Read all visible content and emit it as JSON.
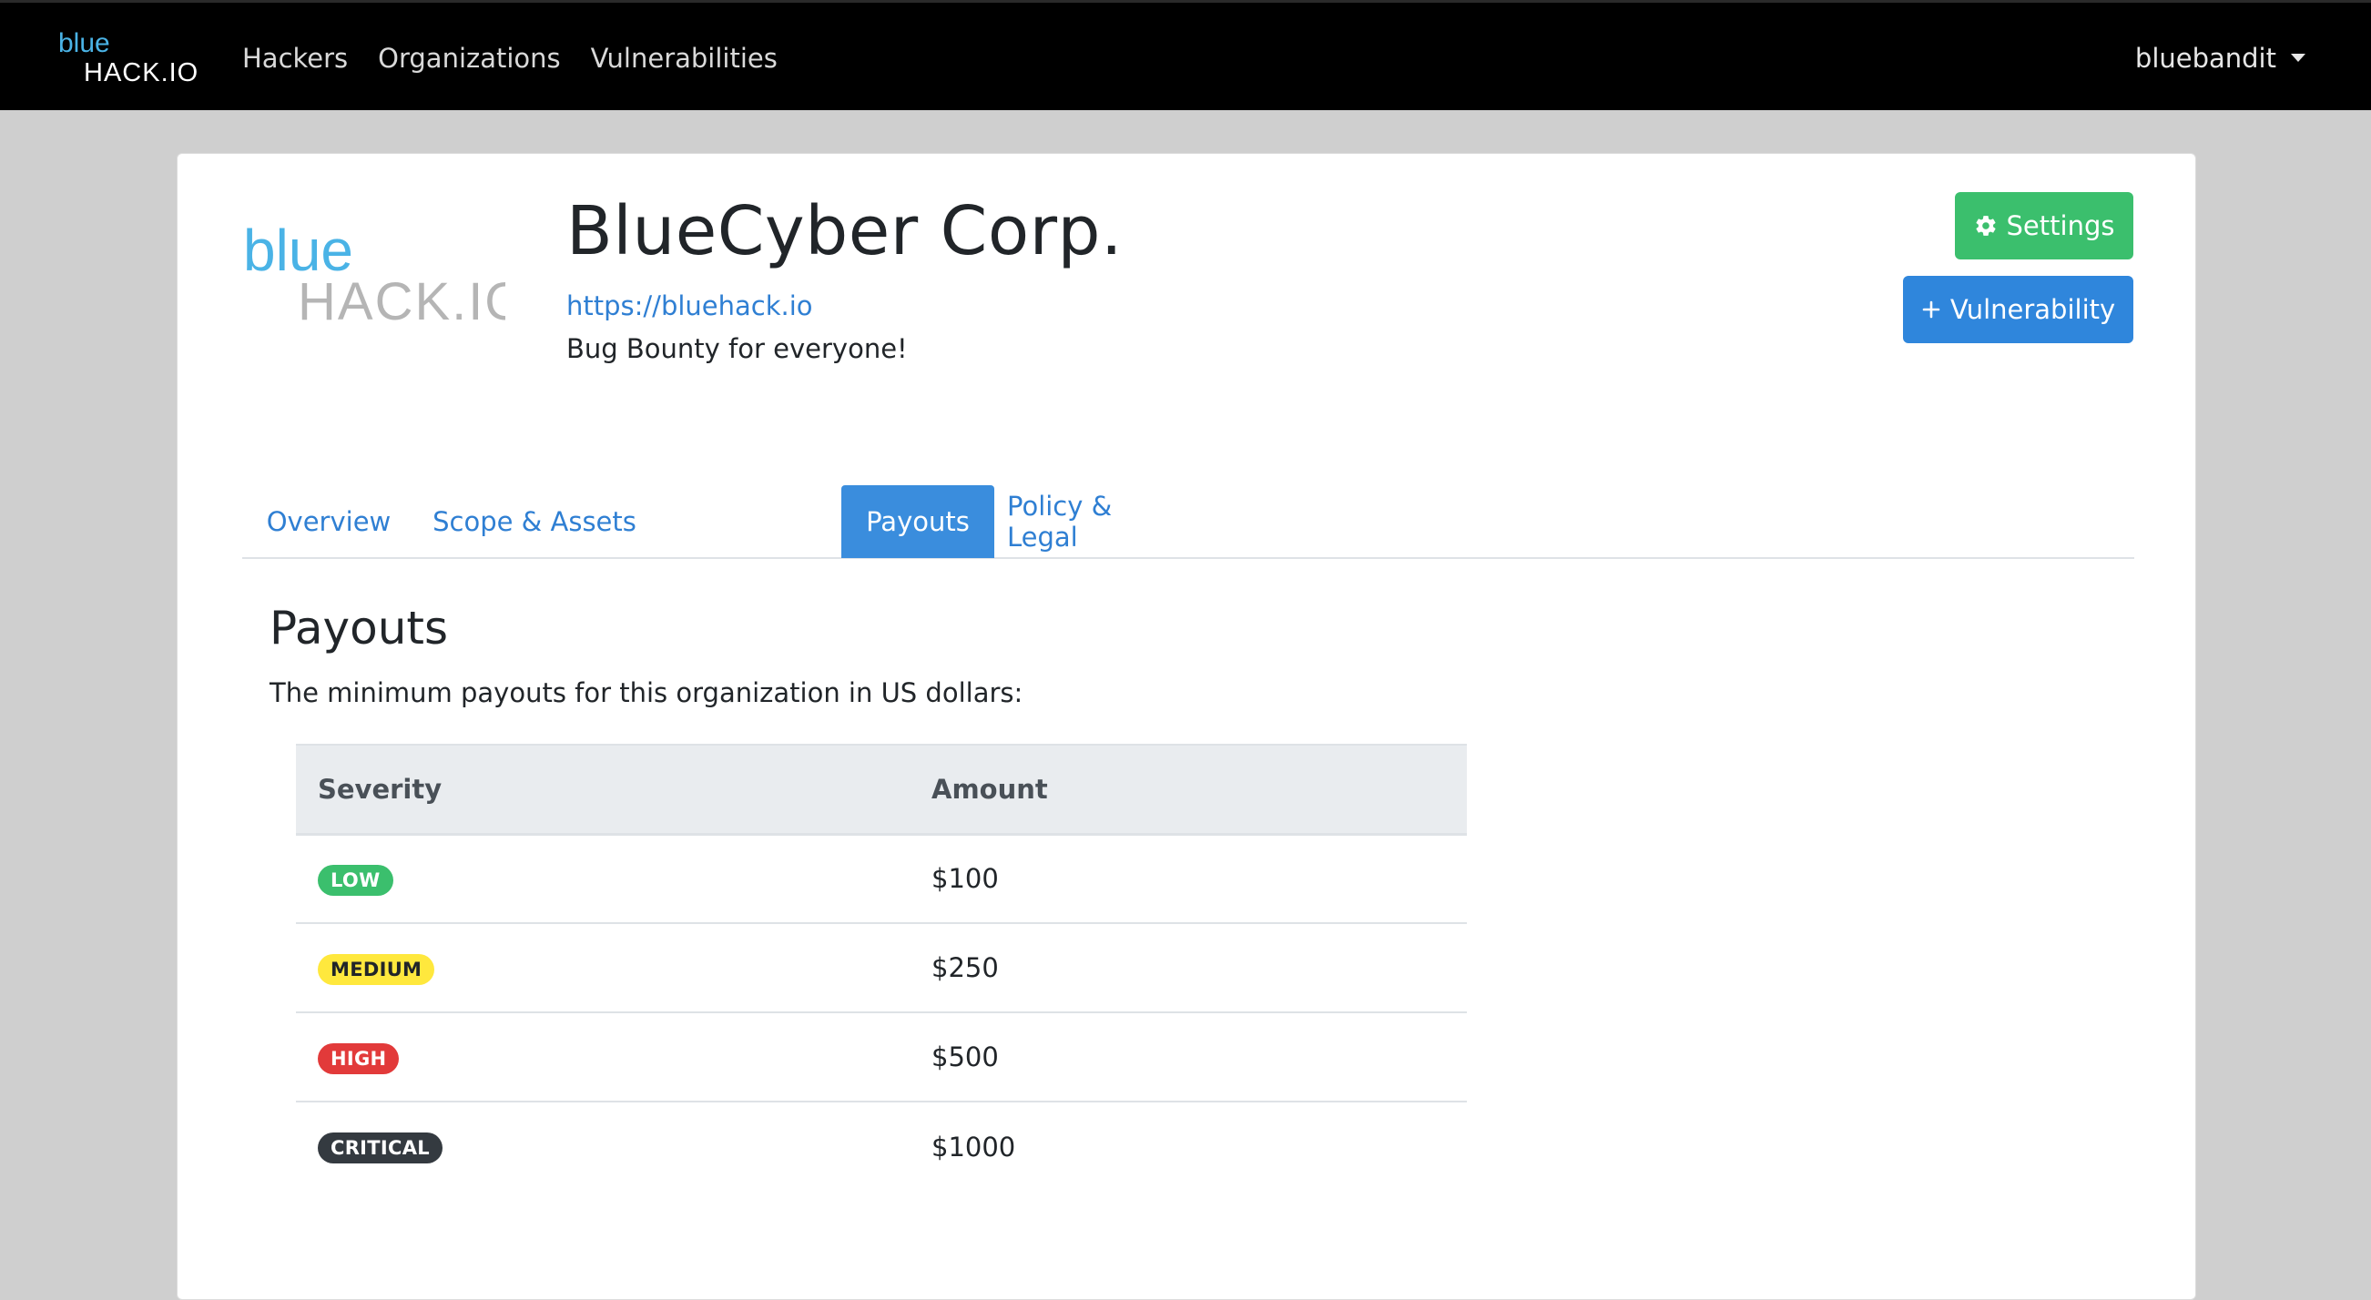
{
  "navbar": {
    "logo_text_top": "blue",
    "logo_text_bottom": "HACK.IO",
    "links": [
      "Hackers",
      "Organizations",
      "Vulnerabilities"
    ],
    "user": "bluebandit"
  },
  "org": {
    "logo_text_top": "blue",
    "logo_text_bottom": "HACK.IO",
    "name": "BlueCyber Corp.",
    "url": "https://bluehack.io",
    "tagline": "Bug Bounty for everyone!"
  },
  "actions": {
    "settings_label": "Settings",
    "vulnerability_label": "Vulnerability",
    "settings_icon": "gear-icon",
    "vulnerability_icon": "plus-icon"
  },
  "tabs": [
    {
      "label": "Overview",
      "active": false
    },
    {
      "label": "Scope & Assets",
      "active": false
    },
    {
      "label": "Payouts",
      "active": true
    },
    {
      "label": "Policy & Legal",
      "active": false
    }
  ],
  "payouts": {
    "title": "Payouts",
    "description": "The minimum payouts for this organization in US dollars:",
    "columns": [
      "Severity",
      "Amount"
    ],
    "rows": [
      {
        "severity": "LOW",
        "amount": "$100",
        "color": "#3bbf6d",
        "text_color": "#ffffff"
      },
      {
        "severity": "MEDIUM",
        "amount": "$250",
        "color": "#ffe83d",
        "text_color": "#212529"
      },
      {
        "severity": "HIGH",
        "amount": "$500",
        "color": "#e23a3a",
        "text_color": "#ffffff"
      },
      {
        "severity": "CRITICAL",
        "amount": "$1000",
        "color": "#343a40",
        "text_color": "#ffffff"
      }
    ]
  },
  "colors": {
    "navbar_bg": "#000000",
    "page_bg": "#cfcfcf",
    "accent_blue": "#2f86dc",
    "success_green": "#3bbf6d"
  }
}
